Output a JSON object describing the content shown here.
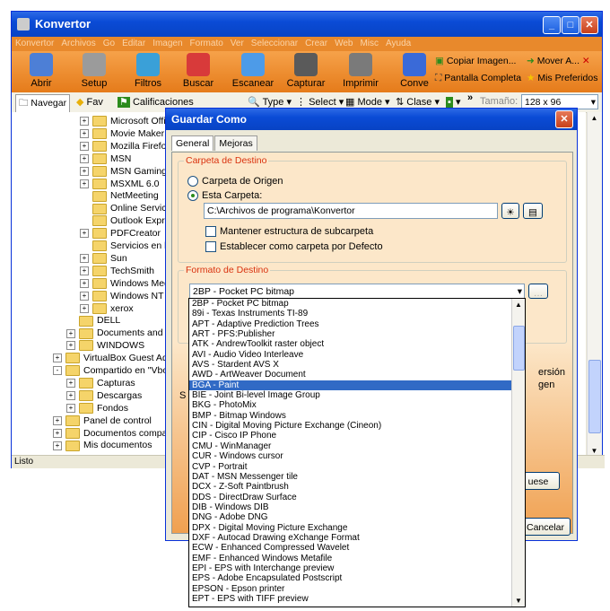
{
  "window": {
    "title": "Konvertor"
  },
  "menu": [
    "Konvertor",
    "Archivos",
    "Go",
    "Editar",
    "Imagen",
    "Formato",
    "Ver",
    "Seleccionar",
    "Crear",
    "Web",
    "Misc",
    "Ayuda"
  ],
  "toolbar": {
    "tools": [
      "Abrir",
      "Setup",
      "Filtros",
      "Buscar",
      "Escanear",
      "Capturar",
      "Imprimir",
      "Conve"
    ],
    "right_items": [
      "Copiar Imagen...",
      "Mover A...",
      "Pantalla Completa",
      "Mis Preferidos"
    ]
  },
  "nav": {
    "navegar": "Navegar",
    "fav": "Fav",
    "calificaciones": "Calificaciones",
    "type": "Type",
    "select": "Select",
    "mode": "Mode",
    "clase": "Clase",
    "tamano_label": "Tamaño:",
    "tamano_value": "128 x 96"
  },
  "tree": [
    {
      "label": "Microsoft Offic",
      "indent": 2,
      "exp": "+"
    },
    {
      "label": "Movie Maker",
      "indent": 2,
      "exp": "+"
    },
    {
      "label": "Mozilla Firefox",
      "indent": 2,
      "exp": "+"
    },
    {
      "label": "MSN",
      "indent": 2,
      "exp": "+"
    },
    {
      "label": "MSN Gaming Z",
      "indent": 2,
      "exp": "+"
    },
    {
      "label": "MSXML 6.0",
      "indent": 2,
      "exp": "+"
    },
    {
      "label": "NetMeeting",
      "indent": 2,
      "exp": ""
    },
    {
      "label": "Online Service",
      "indent": 2,
      "exp": ""
    },
    {
      "label": "Outlook Expre",
      "indent": 2,
      "exp": ""
    },
    {
      "label": "PDFCreator",
      "indent": 2,
      "exp": "+"
    },
    {
      "label": "Servicios en lín",
      "indent": 2,
      "exp": ""
    },
    {
      "label": "Sun",
      "indent": 2,
      "exp": "+"
    },
    {
      "label": "TechSmith",
      "indent": 2,
      "exp": "+"
    },
    {
      "label": "Windows Medi",
      "indent": 2,
      "exp": "+"
    },
    {
      "label": "Windows NT",
      "indent": 2,
      "exp": "+"
    },
    {
      "label": "xerox",
      "indent": 2,
      "exp": "+"
    },
    {
      "label": "DELL",
      "indent": 1,
      "exp": ""
    },
    {
      "label": "Documents and Se",
      "indent": 1,
      "exp": "+"
    },
    {
      "label": "WINDOWS",
      "indent": 1,
      "exp": "+"
    },
    {
      "label": "VirtualBox Guest Addit",
      "indent": 0,
      "exp": "+"
    },
    {
      "label": "Compartido en \"Vbox",
      "indent": 0,
      "exp": "-"
    },
    {
      "label": "Capturas",
      "indent": 1,
      "exp": "+"
    },
    {
      "label": "Descargas",
      "indent": 1,
      "exp": "+"
    },
    {
      "label": "Fondos",
      "indent": 1,
      "exp": "+"
    },
    {
      "label": "Panel de control",
      "indent": 0,
      "exp": "+"
    },
    {
      "label": "Documentos compartic",
      "indent": 0,
      "exp": "+"
    },
    {
      "label": "Mis documentos",
      "indent": 0,
      "exp": "+"
    }
  ],
  "status": "Listo",
  "dialog": {
    "title": "Guardar Como",
    "tabs": [
      "General",
      "Mejoras"
    ],
    "dest_group": "Carpeta de Destino",
    "radio_origen": "Carpeta de Origen",
    "radio_esta": "Esta Carpeta:",
    "path": "C:\\Archivos de programa\\Konvertor",
    "check_subcarpeta": "Mantener estructura de subcarpeta",
    "check_defecto": "Establecer como carpeta por Defecto",
    "format_group": "Formato de Destino",
    "format_selected": "2BP - Pocket PC bitmap",
    "partial_right_1": "ersión",
    "partial_right_2": "gen",
    "partial_btn": "uese",
    "partial_left": "S",
    "cancel": "Cancelar"
  },
  "formats": [
    "2BP - Pocket PC bitmap",
    "89i - Texas Instruments TI-89",
    "APT - Adaptive Prediction Trees",
    "ART - PFS:Publisher",
    "ATK - AndrewToolkit raster object",
    "AVI - Audio Video Interleave",
    "AVS - Stardent AVS X",
    "AWD - ArtWeaver Document",
    "BGA - Paint",
    "BIE - Joint Bi-level Image Group",
    "BKG - PhotoMix",
    "BMP - Bitmap Windows",
    "CIN - Digital Moving Picture Exchange (Cineon)",
    "CIP - Cisco IP Phone",
    "CMU - WinManager",
    "CUR - Windows cursor",
    "CVP - Portrait",
    "DAT - MSN Messenger tile",
    "DCX - Z-Soft Paintbrush",
    "DDS - DirectDraw Surface",
    "DIB - Windows DIB",
    "DNG - Adobe DNG",
    "DPX - Digital Moving Picture Exchange",
    "DXF - Autocad Drawing eXchange Format",
    "ECW - Enhanced Compressed Wavelet",
    "EMF - Enhanced Windows Metafile",
    "EPI - EPS with Interchange preview",
    "EPS - Adobe Encapsulated Postscript",
    "EPSON - Epson printer",
    "EPT - EPS with TIFF preview"
  ],
  "selected_format_index": 8,
  "colors": {
    "accent_orange": "#e57b1a",
    "titlebar_blue": "#0a4bd6",
    "selection": "#316ac5",
    "group_title": "#d9320f"
  }
}
